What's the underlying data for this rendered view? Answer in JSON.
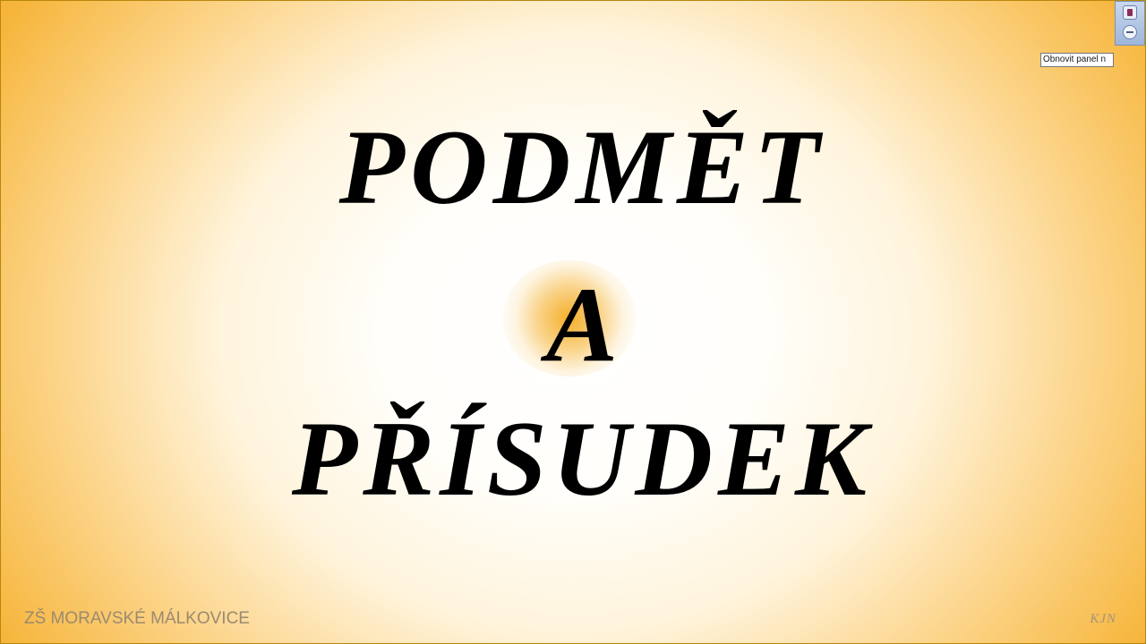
{
  "slide": {
    "title_line_1": "PODMĚT",
    "title_line_2": "A",
    "title_line_3": "PŘÍSUDEK",
    "footer_left": "ZŠ MORAVSKÉ MÁLKOVICE",
    "footer_right": "KJN"
  },
  "panel": {
    "tooltip": "Obnovit panel n",
    "top_button_icon": "stop-icon",
    "bottom_button_icon": "minus-circle-icon"
  },
  "colors": {
    "background_center": "#ffffff",
    "background_edge": "#f6b53a",
    "title_text": "#000000",
    "footer_text": "#9a8a70"
  }
}
